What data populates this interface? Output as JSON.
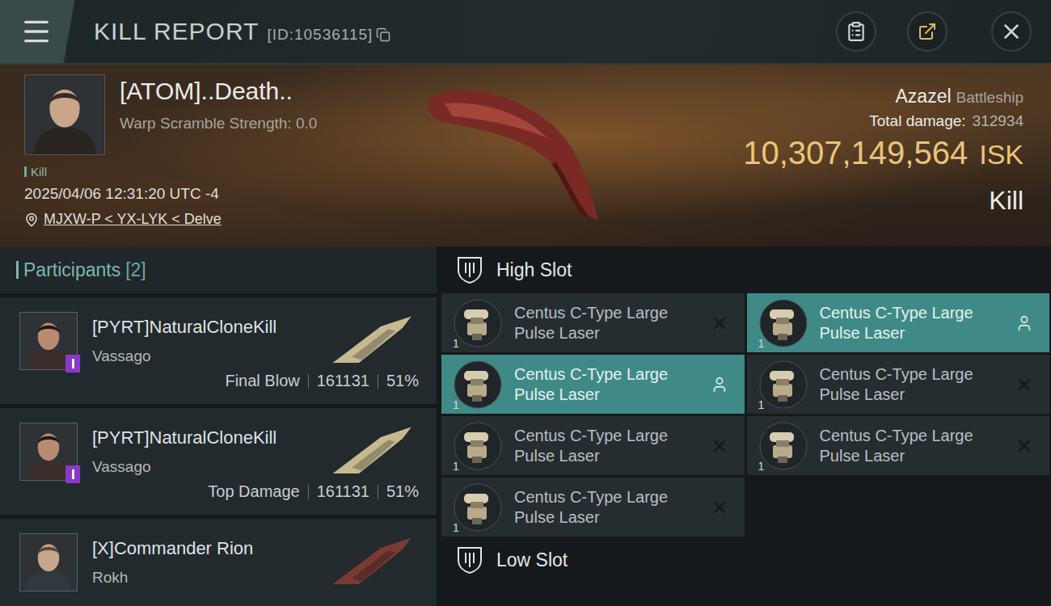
{
  "header": {
    "title": "KILL REPORT",
    "id": "[ID:10536115]"
  },
  "victim": {
    "name": "[ATOM]..Death..",
    "warp_scramble": "Warp Scramble Strength: 0.0",
    "tag": "Kill",
    "time": "2025/04/06 12:31:20 UTC -4",
    "location": "MJXW-P < YX-LYK < Delve",
    "ship": "Azazel",
    "ship_class": "Battleship",
    "total_damage_label": "Total damage:",
    "total_damage": "312934",
    "value": "10,307,149,564",
    "currency": "ISK",
    "result": "Kill"
  },
  "participants": {
    "label": "Participants",
    "count": "[2]",
    "items": [
      {
        "name": "[PYRT]NaturalCloneKill",
        "ship": "Vassago",
        "badge": true,
        "role": "Final Blow",
        "damage": "161131",
        "percent": "51%",
        "color": "#c7b98f"
      },
      {
        "name": "[PYRT]NaturalCloneKill",
        "ship": "Vassago",
        "badge": true,
        "role": "Top Damage",
        "damage": "161131",
        "percent": "51%",
        "color": "#c7b98f"
      },
      {
        "name": "[X]Commander Rion",
        "ship": "Rokh",
        "badge": false,
        "color": "#7a3a34"
      }
    ]
  },
  "slots": [
    {
      "title": "High Slot",
      "items": [
        {
          "name": "Centus C-Type Large Pulse Laser",
          "quantity": "1",
          "dropped": false
        },
        {
          "name": "Centus C-Type Large Pulse Laser",
          "quantity": "1",
          "dropped": true
        },
        {
          "name": "Centus C-Type Large Pulse Laser",
          "quantity": "1",
          "dropped": true
        },
        {
          "name": "Centus C-Type Large Pulse Laser",
          "quantity": "1",
          "dropped": false
        },
        {
          "name": "Centus C-Type Large Pulse Laser",
          "quantity": "1",
          "dropped": false
        },
        {
          "name": "Centus C-Type Large Pulse Laser",
          "quantity": "1",
          "dropped": false
        },
        {
          "name": "Centus C-Type Large Pulse Laser",
          "quantity": "1",
          "dropped": false
        }
      ]
    },
    {
      "title": "Low Slot",
      "items": []
    }
  ]
}
